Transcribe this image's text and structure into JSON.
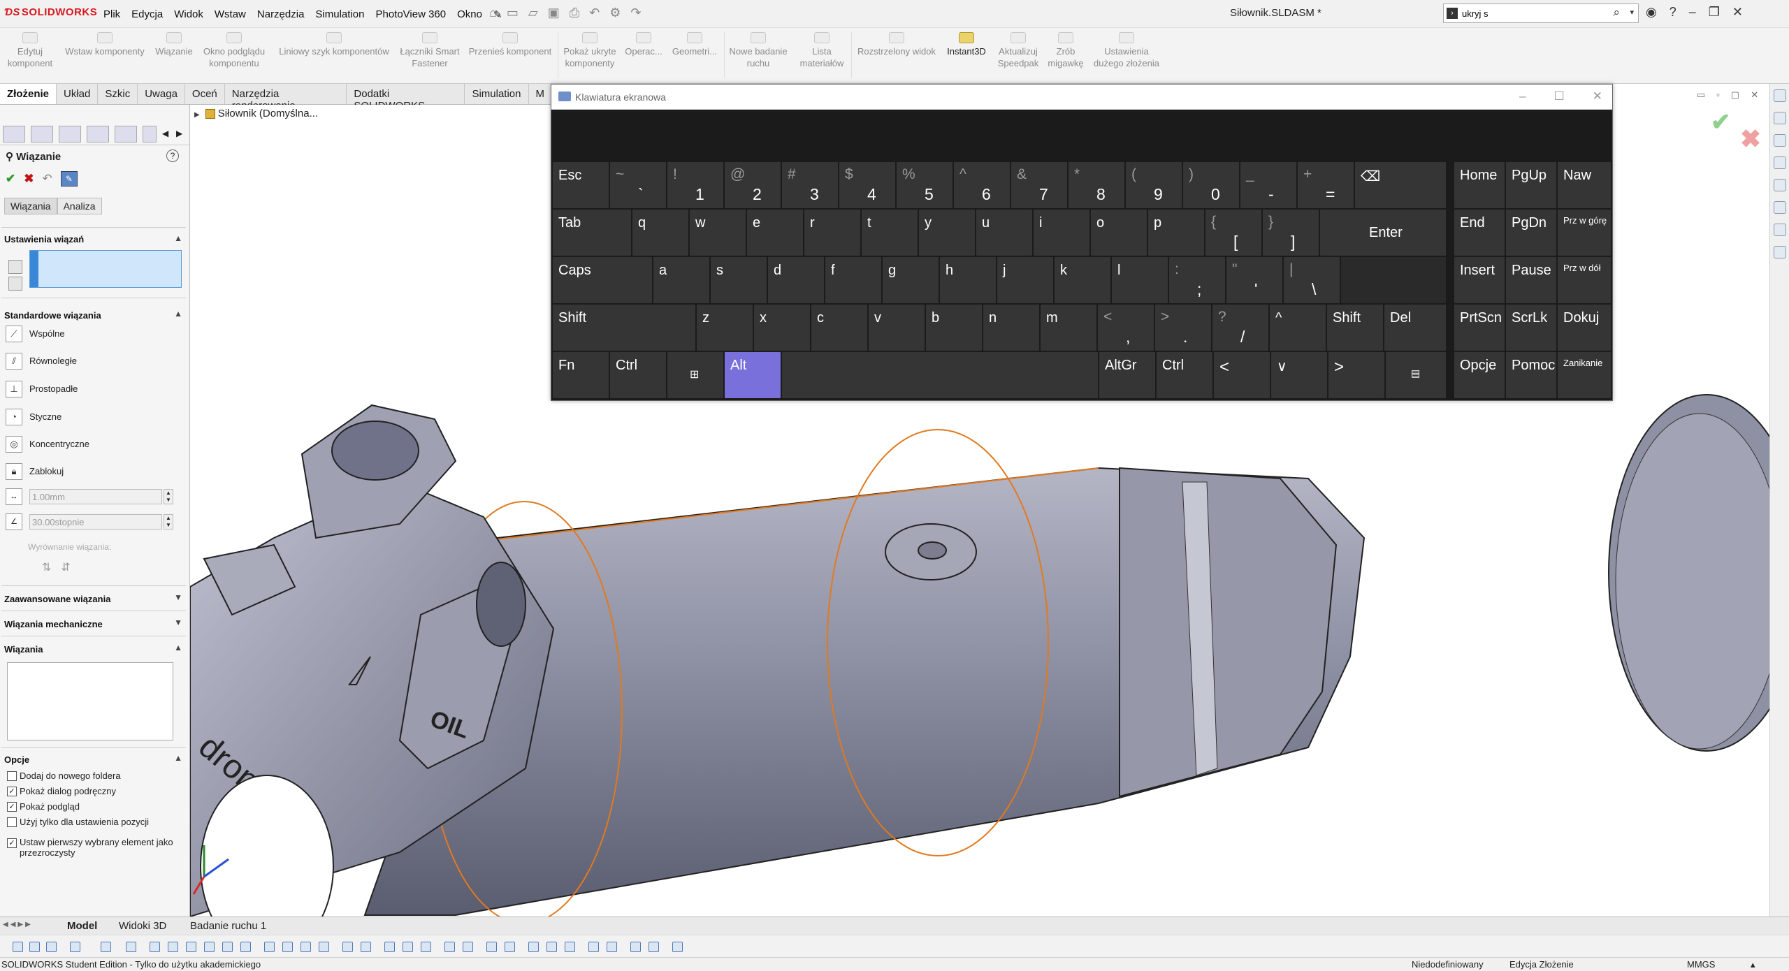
{
  "titlebar": {
    "app_name": "SOLIDWORKS",
    "menus": [
      "Plik",
      "Edycja",
      "Widok",
      "Wstaw",
      "Narzędzia",
      "Simulation",
      "PhotoView 360",
      "Okno"
    ],
    "document_title": "Siłownik.SLDASM *",
    "search_value": "ukryj s"
  },
  "ribbon": {
    "items": [
      {
        "l1": "Edytuj",
        "l2": "komponent"
      },
      {
        "l1": "Wstaw komponenty",
        "l2": ""
      },
      {
        "l1": "Wiązanie",
        "l2": ""
      },
      {
        "l1": "Okno podglądu",
        "l2": "komponentu"
      },
      {
        "l1": "Liniowy szyk komponentów",
        "l2": ""
      },
      {
        "l1": "Łączniki Smart",
        "l2": "Fastener"
      },
      {
        "l1": "Przenieś komponent",
        "l2": ""
      },
      {
        "l1": "Pokaż ukryte",
        "l2": "komponenty"
      },
      {
        "l1": "Operac...",
        "l2": ""
      },
      {
        "l1": "Geometri...",
        "l2": ""
      },
      {
        "l1": "Nowe badanie",
        "l2": "ruchu"
      },
      {
        "l1": "Lista",
        "l2": "materiałów"
      },
      {
        "l1": "Rozstrzelony widok",
        "l2": ""
      },
      {
        "l1": "Instant3D",
        "l2": ""
      },
      {
        "l1": "Aktualizuj",
        "l2": "Speedpak"
      },
      {
        "l1": "Zrób",
        "l2": "migawkę"
      },
      {
        "l1": "Ustawienia",
        "l2": "dużego złożenia"
      }
    ]
  },
  "command_tabs": [
    "Złożenie",
    "Układ",
    "Szkic",
    "Uwaga",
    "Oceń",
    "Narzędzia renderowania",
    "Dodatki SOLIDWORKS",
    "Simulation",
    "M"
  ],
  "property_manager": {
    "title": "Wiązanie",
    "help": "?",
    "subtabs": [
      "Wiązania",
      "Analiza"
    ],
    "section_selections": "Ustawienia wiązań",
    "section_standard": "Standardowe wiązania",
    "standard_mates": [
      "Wspólne",
      "Równoległe",
      "Prostopadłe",
      "Styczne",
      "Koncentryczne",
      "Zablokuj"
    ],
    "distance_value": "1.00mm",
    "angle_value": "30.00stopnie",
    "alignment_label": "Wyrównanie wiązania:",
    "section_advanced": "Zaawansowane wiązania",
    "section_mechanical": "Wiązania mechaniczne",
    "section_mates": "Wiązania",
    "section_options": "Opcje",
    "options": [
      {
        "label": "Dodaj do nowego foldera",
        "checked": false
      },
      {
        "label": "Pokaż dialog podręczny",
        "checked": true
      },
      {
        "label": "Pokaż podgląd",
        "checked": true
      },
      {
        "label": "Użyj tylko dla ustawienia pozycji",
        "checked": false
      },
      {
        "label": "Ustaw pierwszy wybrany element jako przezroczysty",
        "checked": true
      }
    ]
  },
  "tree": {
    "root": "Siłownik  (Domyślna..."
  },
  "osk": {
    "title": "Klawiatura ekranowa",
    "accent": "#7a70dc",
    "keys": {
      "esc": "Esc",
      "n1": "1",
      "n2": "2",
      "n3": "3",
      "n4": "4",
      "n5": "5",
      "n6": "6",
      "n7": "7",
      "n8": "8",
      "n9": "9",
      "n0": "0",
      "s_tilde": "~",
      "s_grave": "`",
      "s1": "!",
      "s2": "@",
      "s3": "#",
      "s4": "$",
      "s5": "%",
      "s6": "^",
      "s7": "&",
      "s8": "*",
      "s9": "(",
      "s0": ")",
      "s_minus": "_",
      "minus": "-",
      "s_plus": "+",
      "eq": "=",
      "bksp": "⌫",
      "tab": "Tab",
      "q": "q",
      "w": "w",
      "e": "e",
      "r": "r",
      "t": "t",
      "y": "y",
      "u": "u",
      "i": "i",
      "o": "o",
      "p": "p",
      "s_lbrace": "{",
      "lbr": "[",
      "s_rbrace": "}",
      "rbr": "]",
      "enter": "Enter",
      "caps": "Caps",
      "a": "a",
      "s": "s",
      "d": "d",
      "f": "f",
      "g": "g",
      "h": "h",
      "j": "j",
      "k": "k",
      "l": "l",
      "s_colon": ":",
      "semi": ";",
      "s_quote": "\"",
      "apos": "'",
      "s_pipe": "|",
      "bsl": "\\",
      "shift": "Shift",
      "z": "z",
      "x": "x",
      "c": "c",
      "v": "v",
      "b": "b",
      "n": "n",
      "m": "m",
      "s_lt": "<",
      "comma": ",",
      "s_gt": ">",
      "dot": ".",
      "s_q": "?",
      "slash": "/",
      "up": "^",
      "shift_r": "Shift",
      "del": "Del",
      "fn": "Fn",
      "ctrl": "Ctrl",
      "win": "⊞",
      "alt": "Alt",
      "altgr": "AltGr",
      "ctrl_r": "Ctrl",
      "left": "<",
      "down": "∨",
      "right": ">",
      "menu": "▤",
      "home": "Home",
      "pgup": "PgUp",
      "naw": "Naw",
      "end": "End",
      "pgdn": "PgDn",
      "przwgore": "Prz w górę",
      "insert": "Insert",
      "pause": "Pause",
      "przwdol": "Prz w dół",
      "prtscn": "PrtScn",
      "scrlk": "ScrLk",
      "dokuj": "Dokuj",
      "opcje": "Opcje",
      "pomoc": "Pomoc",
      "zanikanie": "Zanikanie"
    }
  },
  "model_tabs": [
    "Model",
    "Widoki 3D",
    "Badanie ruchu 1"
  ],
  "model_text": "dronerri",
  "model_oil": "OIL",
  "status": {
    "left": "SOLIDWORKS Student Edition - Tylko do użytku akademickiego",
    "state": "Niedodefiniowany",
    "mode": "Edycja Złożenie",
    "units": "MMGS"
  }
}
